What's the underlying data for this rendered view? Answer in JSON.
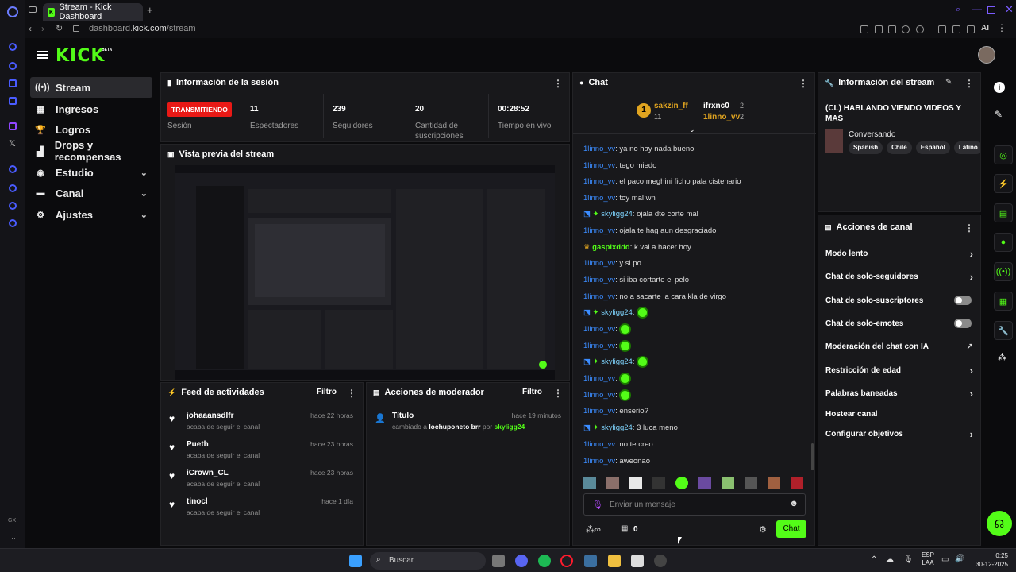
{
  "browser": {
    "tab_title": "Stream - Kick Dashboard",
    "address_prefix": "dashboard.",
    "address_host": "kick.com",
    "address_path": "/stream"
  },
  "app": {
    "logo": "KICK",
    "logo_badge": "BETA"
  },
  "nav": [
    {
      "label": "Stream",
      "icon": "radio-icon"
    },
    {
      "label": "Ingresos",
      "icon": "chart-icon"
    },
    {
      "label": "Logros",
      "icon": "trophy-icon"
    },
    {
      "label": "Drops y recompensas",
      "icon": "gift-icon"
    },
    {
      "label": "Estudio",
      "icon": "palette-icon"
    },
    {
      "label": "Canal",
      "icon": "person-icon"
    },
    {
      "label": "Ajustes",
      "icon": "gear-icon"
    }
  ],
  "session": {
    "title": "Información de la sesión",
    "live_badge": "TRANSMITIENDO",
    "session_label": "Sesión",
    "stats": [
      {
        "value": "11",
        "label": "Espectadores"
      },
      {
        "value": "239",
        "label": "Seguidores"
      },
      {
        "value": "20",
        "label": "Cantidad de suscripciones"
      },
      {
        "value": "00:28:52",
        "label": "Tiempo en vivo"
      }
    ]
  },
  "preview": {
    "title": "Vista previa del stream"
  },
  "feed": {
    "title": "Feed de actividades",
    "filter": "Filtro",
    "items": [
      {
        "name": "johaaansdlfr",
        "sub": "acaba de seguir el canal",
        "time": "hace 22 horas"
      },
      {
        "name": "Pueth",
        "sub": "acaba de seguir el canal",
        "time": "hace 23 horas"
      },
      {
        "name": "iCrown_CL",
        "sub": "acaba de seguir el canal",
        "time": "hace 23 horas"
      },
      {
        "name": "tinocl",
        "sub": "acaba de seguir el canal",
        "time": "hace 1 día"
      }
    ]
  },
  "mod": {
    "title": "Acciones de moderador",
    "filter": "Filtro",
    "item_title": "Título",
    "item_prefix": "cambiado a ",
    "item_value": "lochuponeto brr",
    "item_by": " por ",
    "item_user": "skyligg24",
    "item_time": "hace 19 minutos"
  },
  "chat": {
    "title": "Chat",
    "top_gifters": [
      {
        "name": "sakzin_ff",
        "count": "11"
      },
      {
        "name": "ifrxnc0",
        "count": "2"
      },
      {
        "name": "1linno_vv",
        "count": "2"
      }
    ],
    "messages": [
      {
        "user": "1linno_vv",
        "text": ": ya no hay nada bueno"
      },
      {
        "user": "1linno_vv",
        "text": ": tego miedo"
      },
      {
        "user": "1linno_vv",
        "text": ": el paco meghini ficho pala cistenario"
      },
      {
        "user": "1linno_vv",
        "text": ": toy mal wn"
      },
      {
        "user": "skyligg24",
        "text": ": ojala dte corte mal"
      },
      {
        "user": "1linno_vv",
        "text": ": ojala te hag aun desgraciado"
      },
      {
        "user": "gaspixddd",
        "text": ": k vai a hacer hoy"
      },
      {
        "user": "1linno_vv",
        "text": ": y si po"
      },
      {
        "user": "1linno_vv",
        "text": ": si iba cortarte el pelo"
      },
      {
        "user": "1linno_vv",
        "text": ": no a sacarte la cara kla de virgo"
      },
      {
        "user": "skyligg24",
        "text": ":"
      },
      {
        "user": "1linno_vv",
        "text": ":"
      },
      {
        "user": "1linno_vv",
        "text": ":"
      },
      {
        "user": "skyligg24",
        "text": ":"
      },
      {
        "user": "1linno_vv",
        "text": ":"
      },
      {
        "user": "1linno_vv",
        "text": ":"
      },
      {
        "user": "1linno_vv",
        "text": ": enserio?"
      },
      {
        "user": "skyligg24",
        "text": ": 3 luca meno"
      },
      {
        "user": "1linno_vv",
        "text": ": no te creo"
      },
      {
        "user": "1linno_vv",
        "text": ": aweonao"
      }
    ],
    "placeholder": "Enviar un mensaje",
    "points": "0",
    "send": "Chat"
  },
  "stream_info": {
    "title": "Información del stream",
    "stream_title": "(CL) HABLANDO VIENDO VIDEOS Y MAS",
    "category": "Conversando",
    "tags": [
      "Spanish",
      "Chile",
      "Español",
      "Latino"
    ]
  },
  "channel_actions": {
    "title": "Acciones de canal",
    "items": [
      {
        "label": "Modo lento",
        "control": "arrow"
      },
      {
        "label": "Chat de solo-seguidores",
        "control": "arrow"
      },
      {
        "label": "Chat de solo-suscriptores",
        "control": "toggle"
      },
      {
        "label": "Chat de solo-emotes",
        "control": "toggle"
      },
      {
        "label": "Moderación del chat con IA",
        "control": "external"
      },
      {
        "label": "Restricción de edad",
        "control": "arrow"
      },
      {
        "label": "Palabras baneadas",
        "control": "arrow"
      },
      {
        "label": "Hostear canal",
        "control": "none"
      },
      {
        "label": "Configurar objetivos",
        "control": "arrow"
      }
    ]
  },
  "taskbar": {
    "search": "Buscar",
    "lang": "ESP",
    "lang2": "LAA",
    "time": "0:25",
    "date": "30-12-2025"
  },
  "colors": {
    "accent": "#53fc18",
    "live": "#e91916",
    "panel": "#18181b"
  }
}
